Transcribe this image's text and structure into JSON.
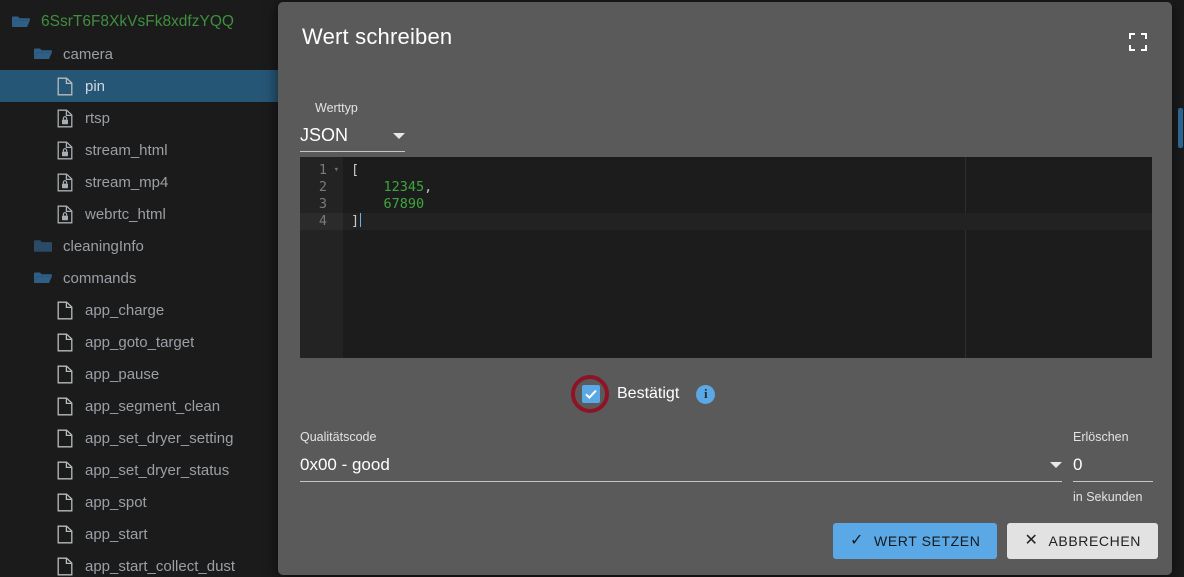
{
  "sidebar": {
    "items": [
      {
        "label": "6SsrT6F8XkVsFk8xdfzYQQ",
        "icon": "folder-open-icon",
        "depth": 0,
        "kind": "root-folder",
        "selected": false
      },
      {
        "label": "camera",
        "icon": "folder-open-icon",
        "depth": 1,
        "kind": "folder",
        "selected": false
      },
      {
        "label": "pin",
        "icon": "file-icon",
        "depth": 2,
        "kind": "file",
        "selected": true
      },
      {
        "label": "rtsp",
        "icon": "file-locked-icon",
        "depth": 2,
        "kind": "file-locked",
        "selected": false
      },
      {
        "label": "stream_html",
        "icon": "file-locked-icon",
        "depth": 2,
        "kind": "file-locked",
        "selected": false
      },
      {
        "label": "stream_mp4",
        "icon": "file-locked-icon",
        "depth": 2,
        "kind": "file-locked",
        "selected": false
      },
      {
        "label": "webrtc_html",
        "icon": "file-locked-icon",
        "depth": 2,
        "kind": "file-locked",
        "selected": false
      },
      {
        "label": "cleaningInfo",
        "icon": "folder-closed-icon",
        "depth": 1,
        "kind": "folder-closed",
        "selected": false
      },
      {
        "label": "commands",
        "icon": "folder-open-icon",
        "depth": 1,
        "kind": "folder",
        "selected": false
      },
      {
        "label": "app_charge",
        "icon": "file-icon",
        "depth": 2,
        "kind": "file",
        "selected": false
      },
      {
        "label": "app_goto_target",
        "icon": "file-icon",
        "depth": 2,
        "kind": "file",
        "selected": false
      },
      {
        "label": "app_pause",
        "icon": "file-icon",
        "depth": 2,
        "kind": "file",
        "selected": false
      },
      {
        "label": "app_segment_clean",
        "icon": "file-icon",
        "depth": 2,
        "kind": "file",
        "selected": false
      },
      {
        "label": "app_set_dryer_setting",
        "icon": "file-icon",
        "depth": 2,
        "kind": "file",
        "selected": false
      },
      {
        "label": "app_set_dryer_status",
        "icon": "file-icon",
        "depth": 2,
        "kind": "file",
        "selected": false
      },
      {
        "label": "app_spot",
        "icon": "file-icon",
        "depth": 2,
        "kind": "file",
        "selected": false
      },
      {
        "label": "app_start",
        "icon": "file-icon",
        "depth": 2,
        "kind": "file",
        "selected": false
      },
      {
        "label": "app_start_collect_dust",
        "icon": "file-icon",
        "depth": 2,
        "kind": "file",
        "selected": false
      }
    ]
  },
  "dialog": {
    "title": "Wert schreiben",
    "fullscreen_icon": "fullscreen-expand-icon",
    "value_type": {
      "label": "Werttyp",
      "selected": "JSON"
    },
    "editor": {
      "language": "json",
      "active_line": 4,
      "lines": [
        {
          "number": "1",
          "foldable": true,
          "active": false,
          "text": "["
        },
        {
          "number": "2",
          "foldable": false,
          "active": false,
          "text": "    12345,"
        },
        {
          "number": "3",
          "foldable": false,
          "active": false,
          "text": "    67890"
        },
        {
          "number": "4",
          "foldable": false,
          "active": true,
          "text": "]"
        }
      ]
    },
    "confirmed": {
      "label": "Bestätigt",
      "checked": true,
      "checkbox_icon": "checkmark-icon",
      "info_icon": "info-icon",
      "annotation": "red-highlight-ring"
    },
    "quality_code": {
      "label": "Qualitätscode",
      "selected": "0x00 - good"
    },
    "expiry": {
      "label": "Erlöschen",
      "value": "0",
      "hint": "in Sekunden"
    },
    "buttons": {
      "primary": {
        "label": "WERT SETZEN",
        "icon": "check-icon"
      },
      "secondary": {
        "label": "ABBRECHEN",
        "icon": "close-x-icon"
      }
    }
  },
  "colors": {
    "accent_blue": "#5aa9e6",
    "selection_blue": "#265676",
    "dialog_bg": "#5a5a5a",
    "editor_bg": "#1c1c1c",
    "sidebar_bg": "#1b1b1b",
    "root_green": "#3f8f3f",
    "number_green": "#3fa63f",
    "annotation_red": "#8d1326"
  }
}
